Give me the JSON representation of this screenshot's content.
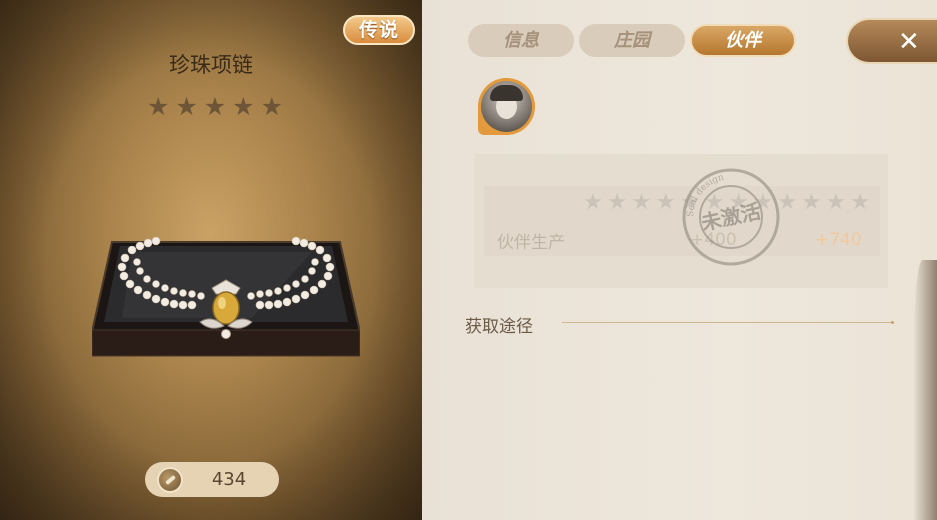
{
  "item": {
    "rarity": "传说",
    "name": "珍珠项链",
    "stars": 5,
    "count": "434"
  },
  "tabs": [
    {
      "label": "信息",
      "active": false
    },
    {
      "label": "庄园",
      "active": false
    },
    {
      "label": "伙伴",
      "active": true
    }
  ],
  "partner": {
    "stars": 12,
    "stat_label": "伙伴生产",
    "stat_value": "+400",
    "stat_value_max": "+740",
    "stamp_text": "未激活",
    "stamp_ring_text": "Seal design"
  },
  "source": {
    "title": "获取途径"
  },
  "icons": {
    "close": "close-icon",
    "count": "compass-icon",
    "star": "star-icon"
  },
  "colors": {
    "accent": "#c98a3f",
    "active_tab": "#c48638",
    "inactive_tab": "#d9ccbb"
  }
}
